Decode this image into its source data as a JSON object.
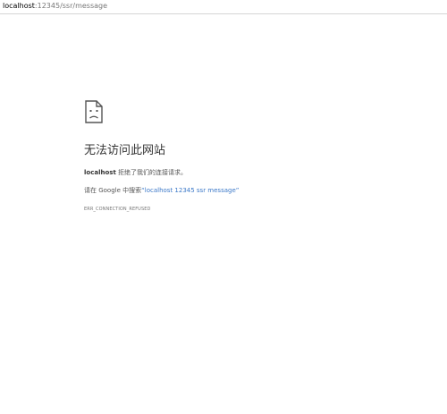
{
  "address_bar": {
    "host": "localhost",
    "path": ":12345/ssr/message"
  },
  "error": {
    "icon": "sad-page-icon",
    "title": "无法访问此网站",
    "host": "localhost",
    "desc_suffix": " 拒绝了我们的连接请求。",
    "search_prefix": "请在 Google 中搜索",
    "search_link": "“localhost 12345 ssr message”",
    "code": "ERR_CONNECTION_REFUSED"
  }
}
